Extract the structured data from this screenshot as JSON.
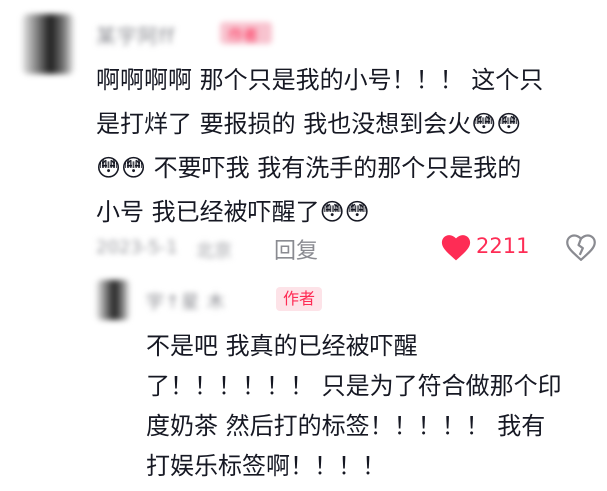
{
  "comment": {
    "username": "某宇阿ff",
    "author_badge_blurred": "作者",
    "text_lines": [
      "啊啊啊啊 那个只是我的小号！！！ 这个只",
      "是打烊了 要报损的 我也没想到会火😳😳",
      "😳😳 不要吓我 我有洗手的那个只是我的",
      "小号 我已经被吓醒了😳😳"
    ],
    "date": "2023-5-1",
    "location": "北京",
    "reply_label": "回复",
    "like_count": "2211",
    "colors": {
      "accent": "#fe2c55",
      "text": "#161823",
      "muted": "#8a8b91"
    }
  },
  "reply": {
    "username": "宇↑星 木",
    "author_badge": "作者",
    "text_lines": [
      "不是吧 我真的已经被吓醒",
      "了！！！！！！ 只是为了符合做那个印",
      "度奶茶 然后打的标签！！！！！ 我有",
      "打娱乐标签啊！！！！"
    ]
  },
  "icons": [
    "heart-icon",
    "broken-heart-icon"
  ]
}
